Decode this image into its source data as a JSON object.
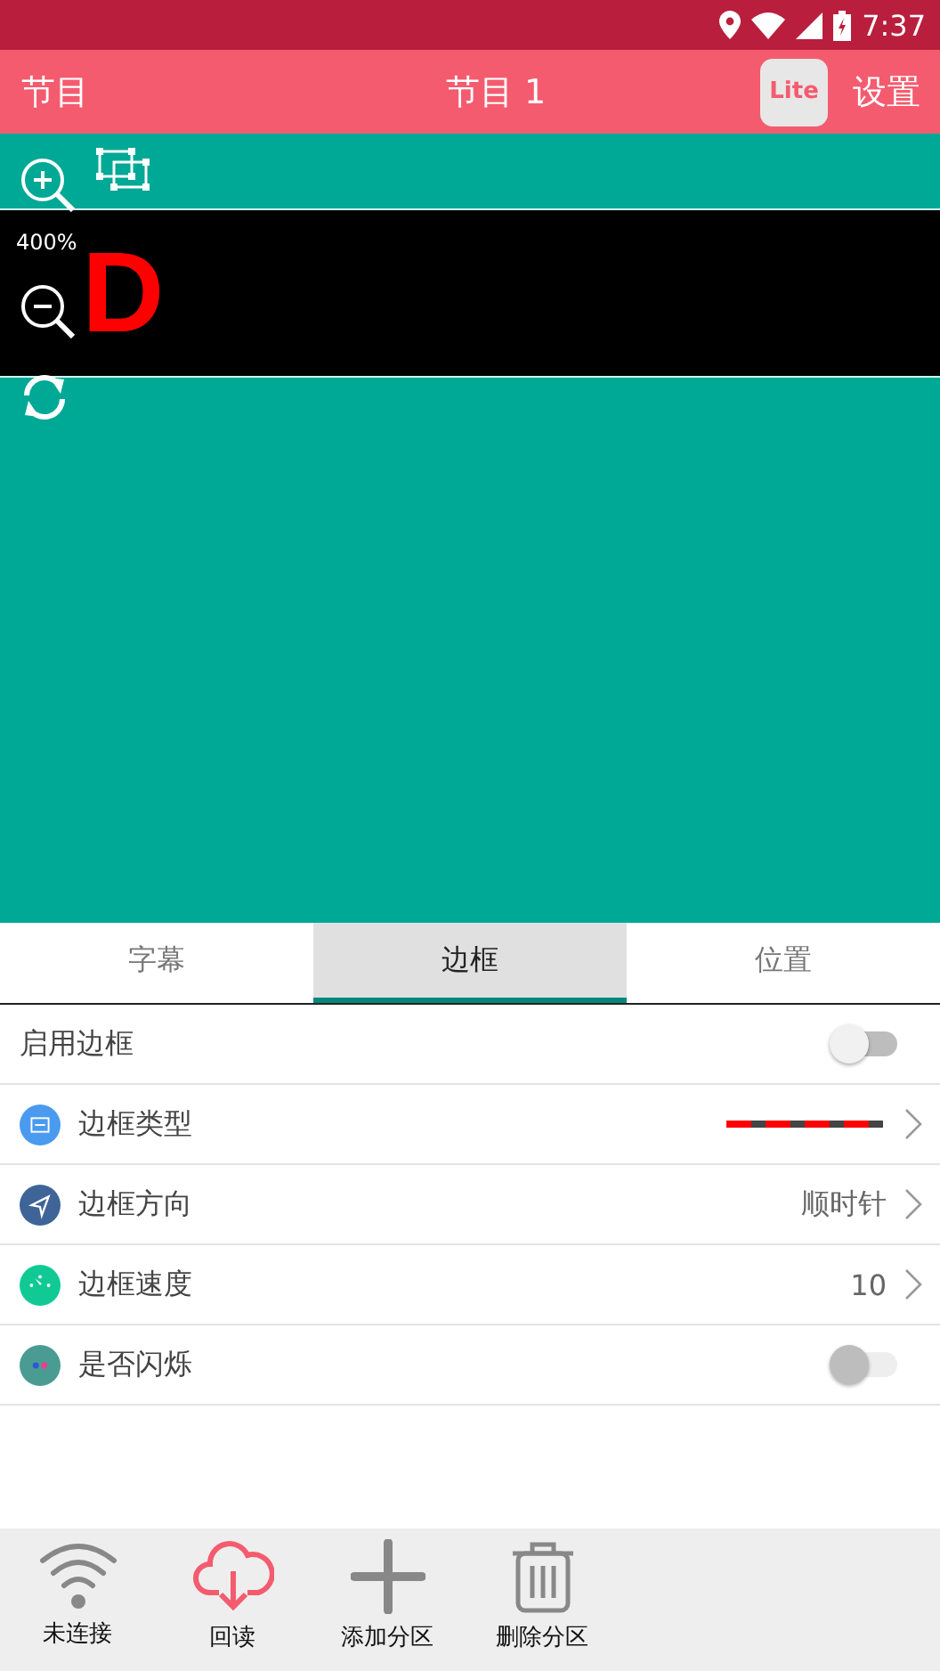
{
  "status_bar": {
    "time": "7:37"
  },
  "app_bar": {
    "left": "节目",
    "title": "节目 1",
    "badge": "Lite",
    "right": "设置"
  },
  "preview": {
    "zoom": "400%",
    "led_text": "D"
  },
  "tabs": [
    {
      "label": "字幕",
      "selected": false
    },
    {
      "label": "边框",
      "selected": true
    },
    {
      "label": "位置",
      "selected": false
    }
  ],
  "settings": [
    {
      "kind": "toggle",
      "label": "启用边框",
      "on": false,
      "disabled": false
    },
    {
      "kind": "line",
      "label": "边框类型",
      "color": "#4a9af0"
    },
    {
      "kind": "value",
      "label": "边框方向",
      "value": "顺时针",
      "color": "#3f6497"
    },
    {
      "kind": "value",
      "label": "边框速度",
      "value": "10",
      "color": "#11c995"
    },
    {
      "kind": "toggle",
      "label": "是否闪烁",
      "on": false,
      "disabled": true,
      "color": "#4a9c93"
    }
  ],
  "bottom_bar": [
    {
      "kind": "wifi",
      "label": "未连接",
      "highlighted": false
    },
    {
      "kind": "cloud",
      "label": "回读",
      "highlighted": true
    },
    {
      "kind": "plus",
      "label": "添加分区",
      "highlighted": false
    },
    {
      "kind": "trash",
      "label": "删除分区",
      "highlighted": false
    }
  ]
}
